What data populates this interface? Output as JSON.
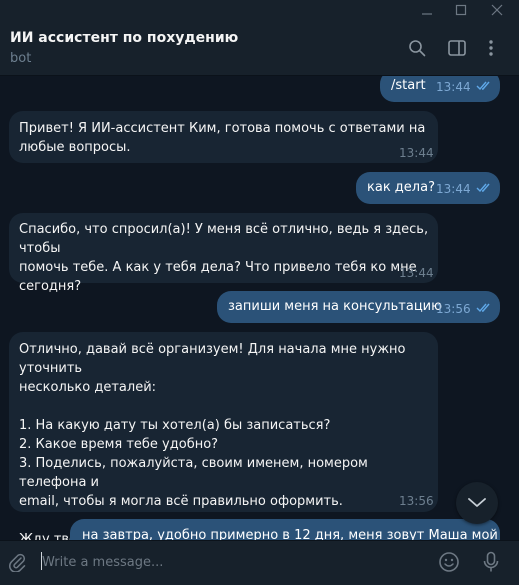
{
  "chat": {
    "title": "ИИ ассистент по похудению",
    "subtitle": "bot"
  },
  "messages": [
    {
      "dir": "out",
      "text": "/start",
      "time": "13:44"
    },
    {
      "dir": "in",
      "text": "Привет! Я ИИ-ассистент Ким, готова помочь с ответами на\nлюбые вопросы.",
      "time": "13:44"
    },
    {
      "dir": "out",
      "text": "как дела?",
      "time": "13:44"
    },
    {
      "dir": "in",
      "text": "Спасибо, что спросил(а)! У меня всё отлично, ведь я здесь, чтобы\nпомочь тебе. А как у тебя дела? Что привело тебя ко мне\nсегодня?",
      "time": "13:44"
    },
    {
      "dir": "out",
      "text": "запиши меня на консультацию",
      "time": "13:56"
    },
    {
      "dir": "in",
      "text": "Отлично, давай всё организуем! Для начала мне нужно уточнить\nнесколько деталей:\n\n1. На какую дату ты хотел(а) бы записаться?\n2. Какое время тебе удобно?\n3. Поделись, пожалуйста, своим именем, номером телефона и\nemail, чтобы я могла всё правильно оформить.\n\nЖду твоих ответов, и мы сразу всё забронируем!",
      "time": "13:56"
    },
    {
      "dir": "out",
      "text": "на завтра, удобно примерно в 12 дня, меня зовут Маша мой",
      "time": ""
    }
  ],
  "composer": {
    "placeholder": "Write a message..."
  },
  "icons": {
    "minimize": "minimize-icon",
    "maximize": "maximize-icon",
    "close": "close-icon",
    "search": "search-icon",
    "sidebar": "sidebar-toggle-icon",
    "more": "more-vert-icon",
    "scroll": "chevron-down-icon",
    "attach": "paperclip-icon",
    "emoji": "emoji-icon",
    "mic": "microphone-icon",
    "read": "double-check-icon"
  },
  "colors": {
    "background": "#0e1621",
    "panel": "#17212b",
    "incoming_bubble": "#182533",
    "outgoing_bubble": "#2b5278",
    "read_check": "#5fa8e8",
    "muted_text": "#6d7f8f"
  }
}
